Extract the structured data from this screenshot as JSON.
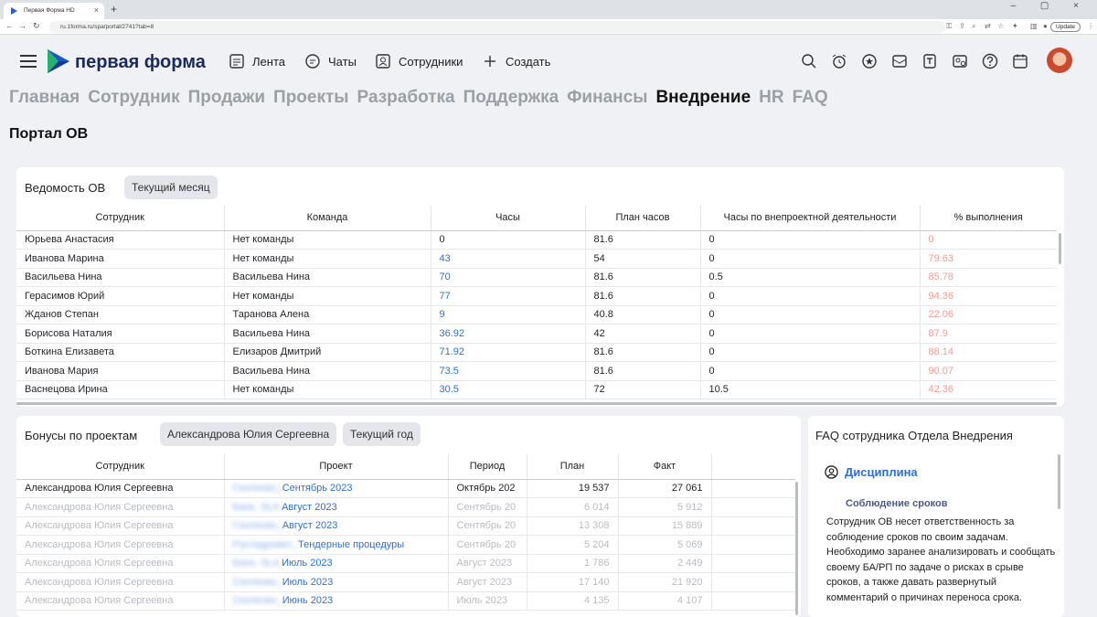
{
  "browser": {
    "tab_title": "Первая Форма HD",
    "url": "ru.1forma.ru/spa/portal/2741?tab=8",
    "update_label": "Update"
  },
  "header": {
    "brand": "первая форма",
    "nav": [
      {
        "label": "Лента",
        "icon": "feed-icon"
      },
      {
        "label": "Чаты",
        "icon": "chat-icon"
      },
      {
        "label": "Сотрудники",
        "icon": "employees-icon"
      },
      {
        "label": "Создать",
        "icon": "plus-icon"
      }
    ]
  },
  "modules": [
    "Главная",
    "Сотрудник",
    "Продажи",
    "Проекты",
    "Разработка",
    "Поддержка",
    "Финансы",
    "Внедрение",
    "HR",
    "FAQ"
  ],
  "active_module": "Внедрение",
  "page_title": "Портал ОВ",
  "vedomost": {
    "title": "Ведомость ОВ",
    "filter": "Текущий месяц",
    "columns": [
      "Сотрудник",
      "Команда",
      "Часы",
      "План часов",
      "Часы по внепроектной деятельности",
      "% выполнения"
    ],
    "rows": [
      [
        "Юрьева Анастасия",
        "Нет команды",
        "0",
        "81.6",
        "0",
        "0"
      ],
      [
        "Иванова Марина",
        "Нет команды",
        "43",
        "54",
        "0",
        "79.63"
      ],
      [
        "Васильева Нина",
        "Васильева Нина",
        "70",
        "81.6",
        "0.5",
        "85.78"
      ],
      [
        "Герасимов Юрий",
        "Нет команды",
        "77",
        "81.6",
        "0",
        "94.36"
      ],
      [
        "Жданов Степан",
        "Таранова Алена",
        "9",
        "40.8",
        "0",
        "22.06"
      ],
      [
        "Борисова Наталия",
        "Васильева Нина",
        "36.92",
        "42",
        "0",
        "87.9"
      ],
      [
        "Боткина Елизавета",
        "Елизаров Дмитрий",
        "71.92",
        "81.6",
        "0",
        "88.14"
      ],
      [
        "Иванова Мария",
        "Васильева Нина",
        "73.5",
        "81.6",
        "0",
        "90.07"
      ],
      [
        "Васнецова Ирина",
        "Нет команды",
        "30.5",
        "72",
        "10.5",
        "42.36"
      ]
    ]
  },
  "bonuses": {
    "title": "Бонусы по проектам",
    "filter_person": "Александрова Юлия Сергеевна",
    "filter_period": "Текущий год",
    "columns": [
      "Сотрудник",
      "Проект",
      "Период",
      "План",
      "Факт"
    ],
    "rows": [
      {
        "employee": "Александрова Юлия Сергеевна",
        "project_blur": "Сколково_",
        "project": "Сентябрь 2023",
        "period": "Октябрь 202",
        "plan": "19 537",
        "fact": "27 061"
      },
      {
        "employee": "Александрова Юлия Сергеевна",
        "project_blur": "Банк. SLA ",
        "project": "Август 2023",
        "period": "Сентябрь 20",
        "plan": "6 014",
        "fact": "5 912"
      },
      {
        "employee": "Александрова Юлия Сергеевна",
        "project_blur": "Сколково_",
        "project": "Август 2023",
        "period": "Сентябрь 20",
        "plan": "13 308",
        "fact": "15 889"
      },
      {
        "employee": "Александрова Юлия Сергеевна",
        "project_blur": "Русгидромет_",
        "project": "Тендерные процедуры",
        "period": "Сентябрь 20",
        "plan": "5 204",
        "fact": "5 069"
      },
      {
        "employee": "Александрова Юлия Сергеевна",
        "project_blur": "Банк. SLA ",
        "project": "Июль 2023",
        "period": "Август 2023",
        "plan": "1 786",
        "fact": "2 449"
      },
      {
        "employee": "Александрова Юлия Сергеевна",
        "project_blur": "Сколково_",
        "project": "Июль 2023",
        "period": "Август 2023",
        "plan": "17 140",
        "fact": "21 920"
      },
      {
        "employee": "Александрова Юлия Сергеевна",
        "project_blur": "Сколково_",
        "project": "Июнь 2023",
        "period": "Июль 2023",
        "plan": "4 135",
        "fact": "4 107"
      }
    ]
  },
  "faq": {
    "title": "FAQ сотрудника Отдела Внедрения",
    "section": "Дисциплина",
    "subsection": "Соблюдение сроков",
    "text": "Сотрудник ОВ несет ответственность за соблюдение сроков по своим задачам. Необходимо заранее анализировать и сообщать своему БА/РП по задаче о рисках в срыве сроков, а также давать развернутый комментарий о причинах переноса срока."
  },
  "colors": {
    "link": "#2d6ed8",
    "percent": "#f49b92",
    "brand_dark": "#1b2a5c"
  }
}
